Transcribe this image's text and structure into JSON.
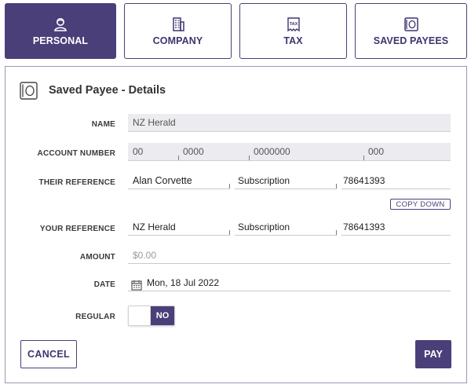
{
  "tabs": [
    {
      "label": "PERSONAL",
      "icon": "person-icon",
      "active": true
    },
    {
      "label": "COMPANY",
      "icon": "building-icon",
      "active": false
    },
    {
      "label": "TAX",
      "icon": "tax-icon",
      "active": false
    },
    {
      "label": "SAVED PAYEES",
      "icon": "saved-payee-icon",
      "active": false
    }
  ],
  "panel": {
    "title": "Saved Payee - Details",
    "icon": "payee-card-icon"
  },
  "form": {
    "name": {
      "label": "NAME",
      "value": "NZ Herald"
    },
    "account_number": {
      "label": "ACCOUNT NUMBER",
      "bank": "00",
      "branch": "0000",
      "account": "0000000",
      "suffix": "000"
    },
    "their_reference": {
      "label": "THEIR REFERENCE",
      "particulars": "Alan Corvette",
      "code": "Subscription",
      "reference": "78641393"
    },
    "copy_down": "COPY DOWN",
    "your_reference": {
      "label": "YOUR REFERENCE",
      "particulars": "NZ Herald",
      "code": "Subscription",
      "reference": "78641393"
    },
    "amount": {
      "label": "AMOUNT",
      "placeholder": "$0.00"
    },
    "date": {
      "label": "DATE",
      "value": "Mon, 18 Jul 2022",
      "icon": "calendar-icon"
    },
    "regular": {
      "label": "REGULAR",
      "state": "NO"
    }
  },
  "actions": {
    "cancel": "CANCEL",
    "pay": "PAY"
  },
  "colors": {
    "accent": "#4b3f7a",
    "field_bg": "#ececf0"
  }
}
